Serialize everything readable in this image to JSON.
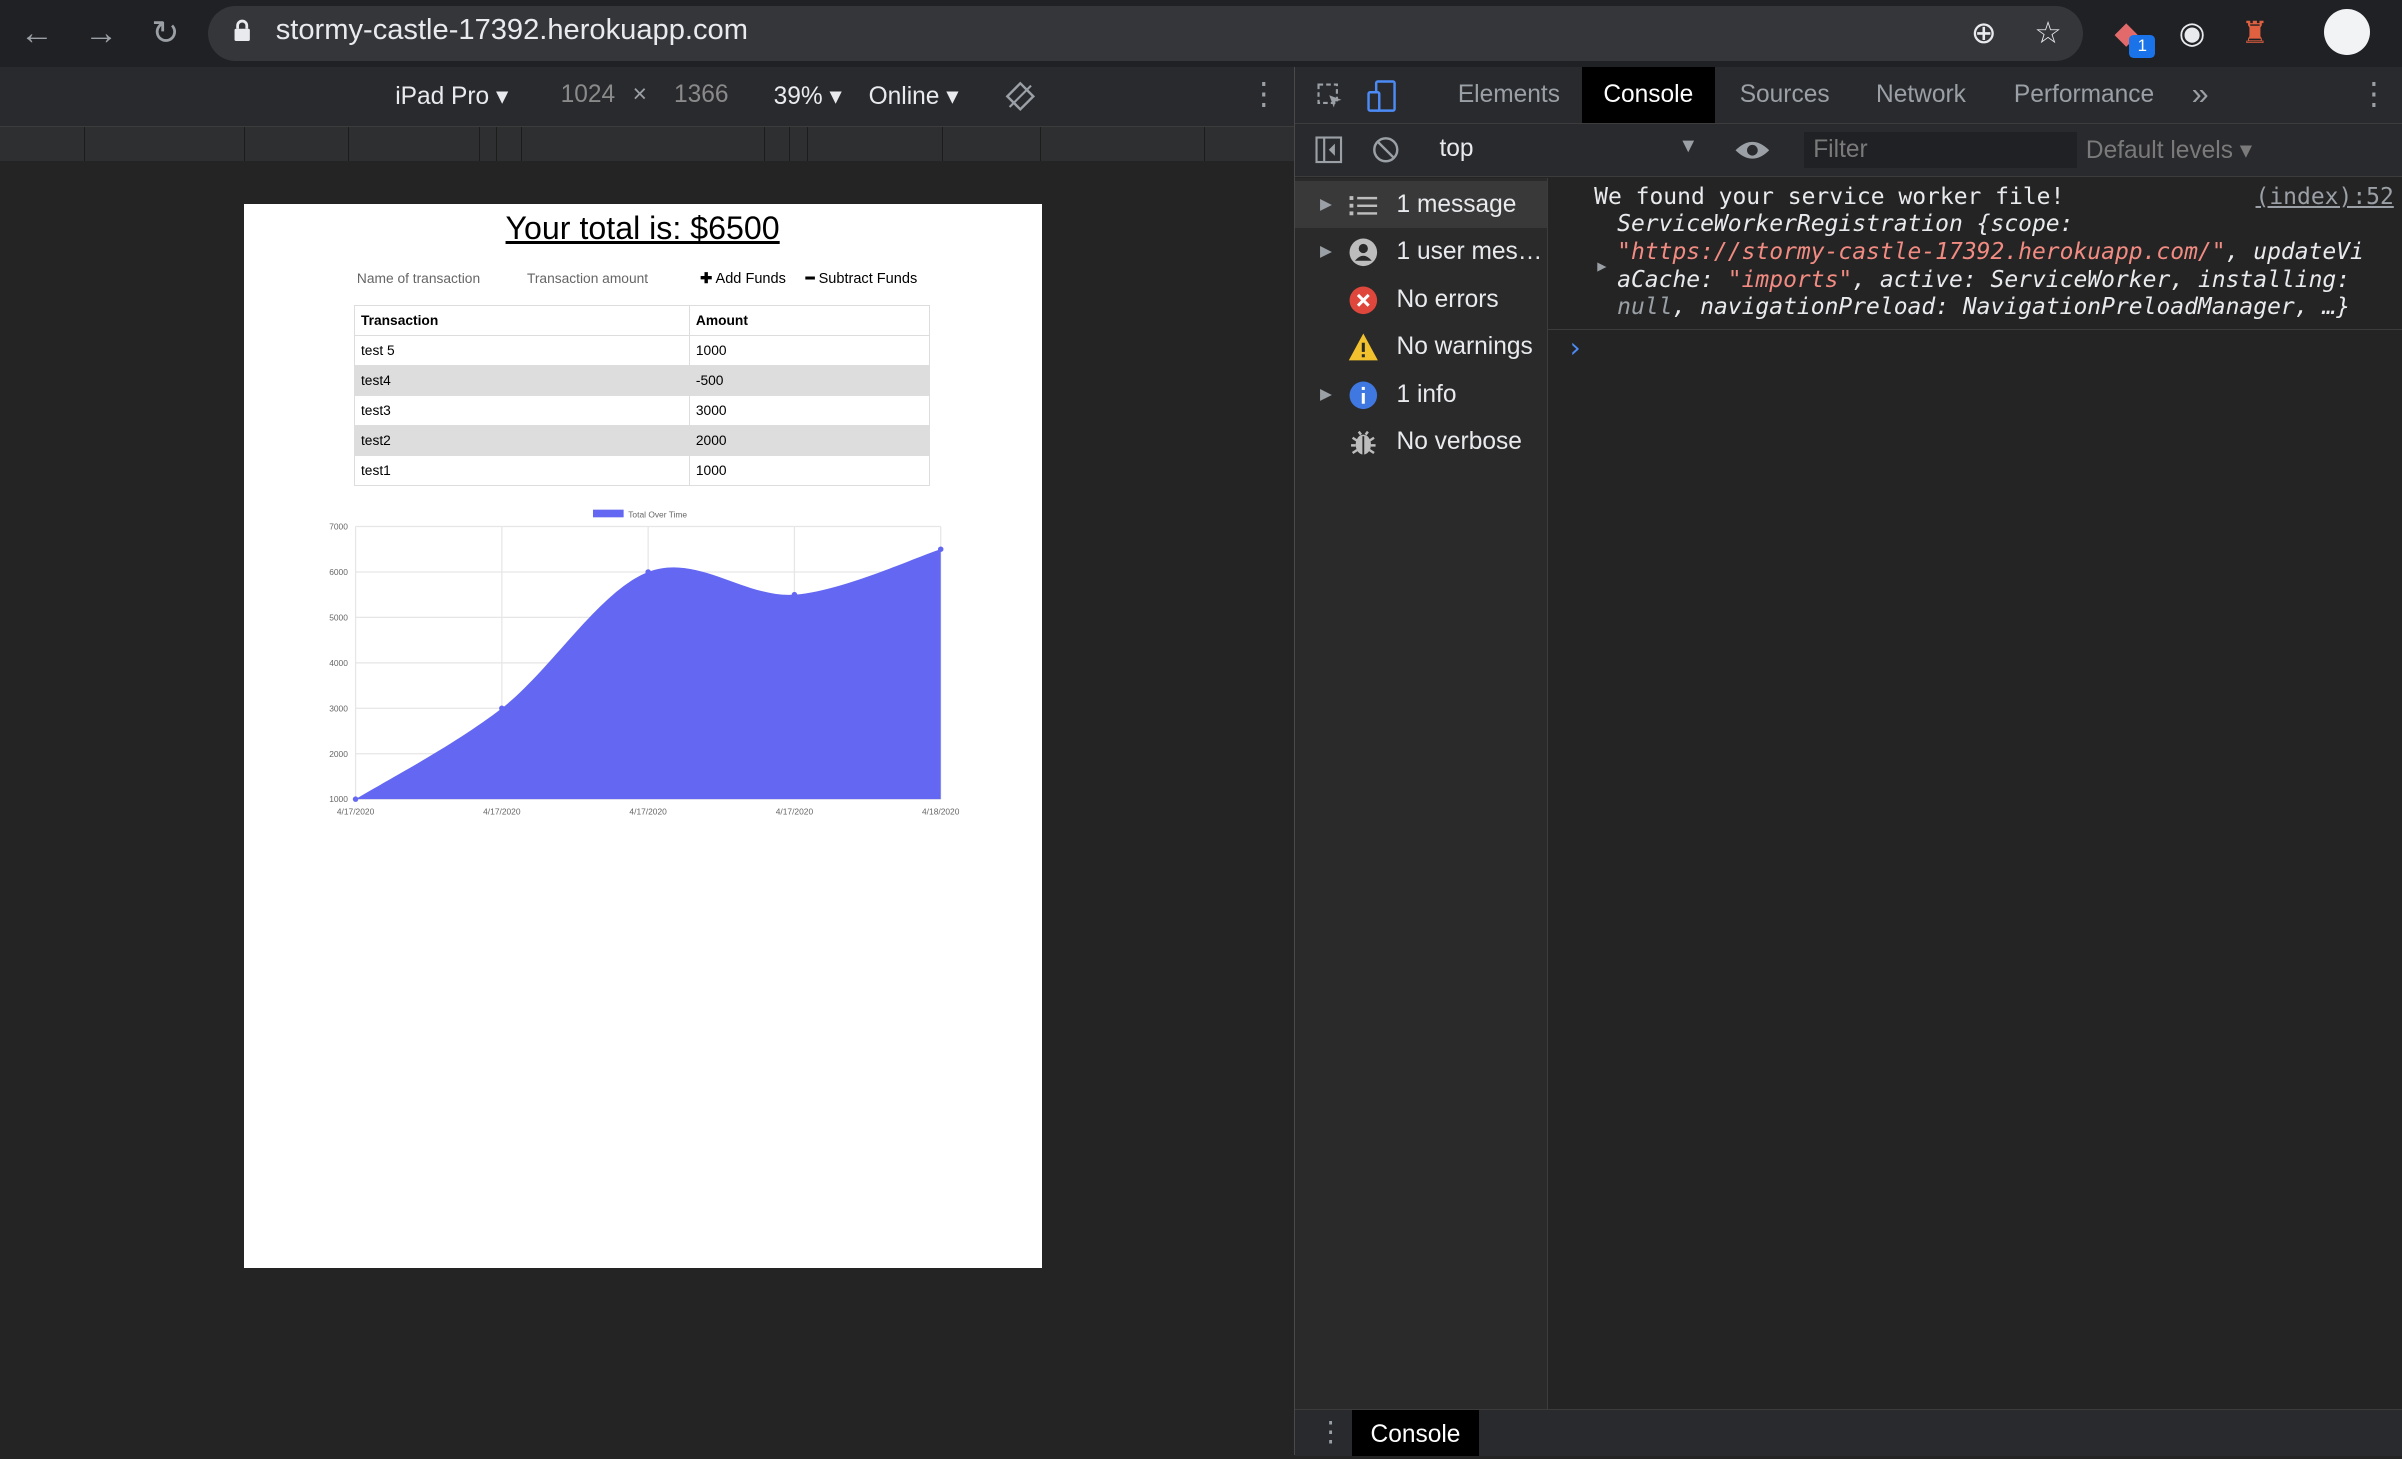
{
  "browser": {
    "url": "stormy-castle-17392.herokuapp.com",
    "extension_badge": "1"
  },
  "device_toolbar": {
    "device": "iPad Pro",
    "width": "1024",
    "times": "×",
    "height": "1366",
    "zoom": "39%",
    "network": "Online"
  },
  "page": {
    "total": "Your total is: $6500",
    "name_placeholder": "Name of transaction",
    "amount_placeholder": "Transaction amount",
    "add_button": "Add Funds",
    "subtract_button": "Subtract Funds",
    "table": {
      "headers": [
        "Transaction",
        "Amount"
      ],
      "rows": [
        [
          "test 5",
          "1000"
        ],
        [
          "test4",
          "-500"
        ],
        [
          "test3",
          "3000"
        ],
        [
          "test2",
          "2000"
        ],
        [
          "test1",
          "1000"
        ]
      ]
    }
  },
  "chart_data": {
    "type": "area",
    "title": "",
    "legend": "Total Over Time",
    "x": [
      "4/17/2020",
      "4/17/2020",
      "4/17/2020",
      "4/17/2020",
      "4/18/2020"
    ],
    "series": [
      {
        "name": "Total Over Time",
        "values": [
          1000,
          3000,
          6000,
          5500,
          6500
        ]
      }
    ],
    "ylim": [
      1000,
      7000
    ],
    "yticks": [
      1000,
      2000,
      3000,
      4000,
      5000,
      6000,
      7000
    ],
    "grid": true,
    "color": "#6467f2"
  },
  "devtools": {
    "tabs": [
      "Elements",
      "Console",
      "Sources",
      "Network",
      "Performance"
    ],
    "more": "»",
    "context": "top",
    "filter_placeholder": "Filter",
    "levels": "Default levels",
    "sidebar": [
      {
        "label": "1 message",
        "icon": "list-icon",
        "expandable": true
      },
      {
        "label": "1 user mes…",
        "icon": "user-icon",
        "expandable": true
      },
      {
        "label": "No errors",
        "icon": "error-icon",
        "expandable": false
      },
      {
        "label": "No warnings",
        "icon": "warning-icon",
        "expandable": false
      },
      {
        "label": "1 info",
        "icon": "info-icon",
        "expandable": true
      },
      {
        "label": "No verbose",
        "icon": "bug-icon",
        "expandable": false
      }
    ],
    "console": {
      "message": "We found your service worker file!",
      "source": "(index):52",
      "obj_line1": "ServiceWorkerRegistration {scope:",
      "obj_url": "\"https://stormy-castle-17392.herokuapp.com/\"",
      "obj_line2_rest": ", updateVi",
      "obj_line3_a": "aCache: ",
      "obj_line3_str": "\"imports\"",
      "obj_line3_b": ", active: ServiceWorker, installing:",
      "obj_line4_null": "null",
      "obj_line4_rest": ", navigationPreload: NavigationPreloadManager, …}",
      "prompt": "›"
    },
    "bottom_tab": "Console"
  },
  "colors": {
    "chart_fill": "#6467f2",
    "error": "#e0473c",
    "warning": "#f2c12e",
    "info": "#3f78e0",
    "string": "#f28b82",
    "link_blue": "#4c8bf5"
  }
}
